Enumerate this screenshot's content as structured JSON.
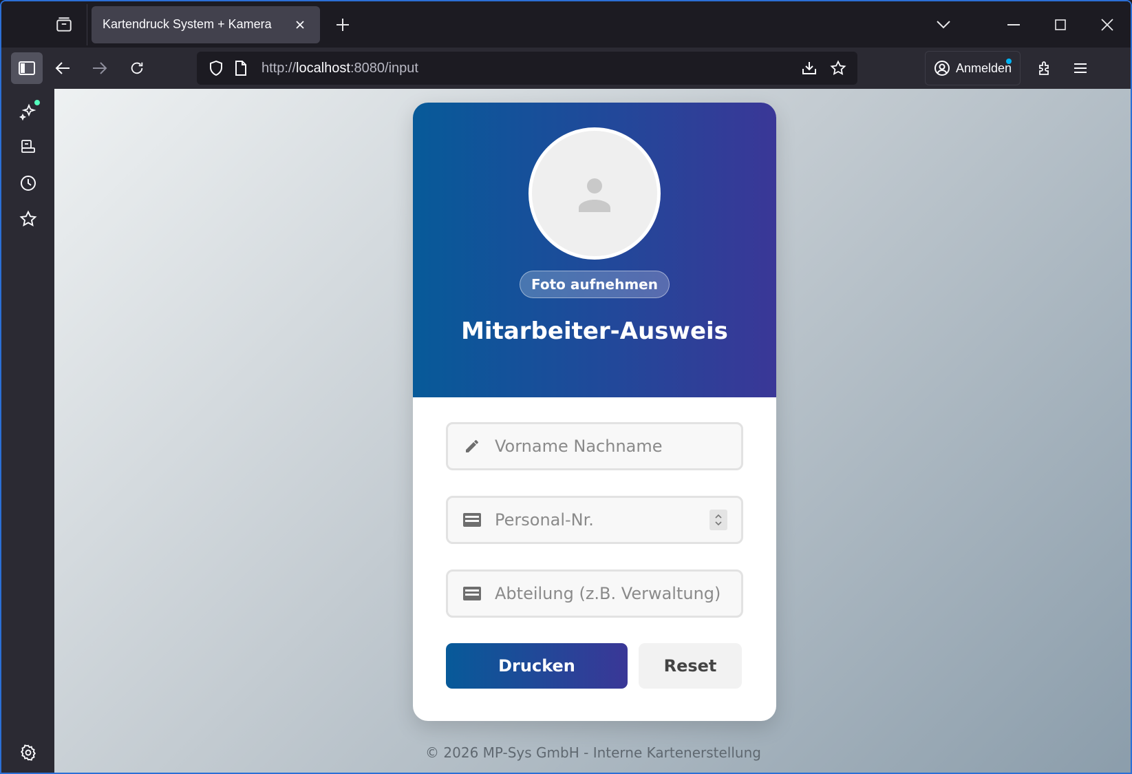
{
  "browser": {
    "tab": {
      "title": "Kartendruck System + Kamera"
    },
    "url": {
      "scheme": "http://",
      "host": "localhost",
      "rest": ":8080/input"
    },
    "signin_label": "Anmelden"
  },
  "card": {
    "photo_button": "Foto aufnehmen",
    "title": "Mitarbeiter-Ausweis",
    "fields": {
      "name_placeholder": "Vorname Nachname",
      "personal_nr_placeholder": "Personal-Nr.",
      "department_placeholder": "Abteilung (z.B. Verwaltung)"
    },
    "print_button": "Drucken",
    "reset_button": "Reset"
  },
  "footer": "© 2026 MP-Sys GmbH - Interne Kartenerstellung",
  "colors": {
    "header_start": "#075a99",
    "header_end": "#3a3797",
    "accent_dot": "#00b3f4",
    "sidebar_dot": "#54ffbd"
  },
  "icons": {
    "tabs": "tab-list-icon",
    "close": "close-icon",
    "new_tab": "plus-icon",
    "sidebar_toggle": "sidebar-icon",
    "back": "arrow-left-icon",
    "forward": "arrow-right-icon",
    "reload": "reload-icon",
    "shield": "shield-icon",
    "page": "page-icon",
    "download": "download-icon",
    "bookmark": "star-icon",
    "account": "account-icon",
    "extensions": "puzzle-icon",
    "menu": "hamburger-icon",
    "name_field": "pencil-icon",
    "id_field": "card-icon",
    "settings": "gear-icon"
  }
}
